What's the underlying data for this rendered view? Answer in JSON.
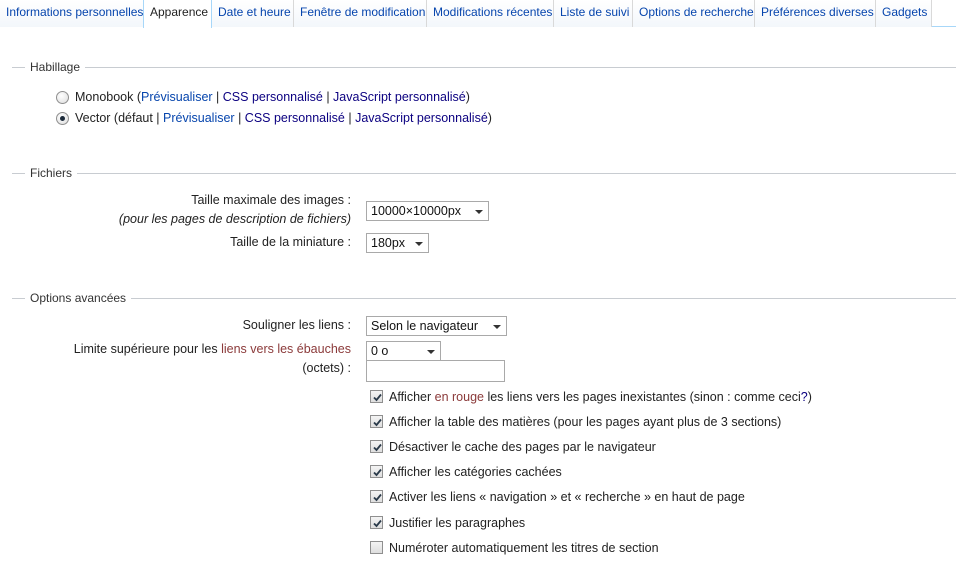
{
  "tabs": [
    {
      "label": "Informations personnelles",
      "active": false
    },
    {
      "label": "Apparence",
      "active": true
    },
    {
      "label": "Date et heure",
      "active": false
    },
    {
      "label": "Fenêtre de modification",
      "active": false
    },
    {
      "label": "Modifications récentes",
      "active": false
    },
    {
      "label": "Liste de suivi",
      "active": false
    },
    {
      "label": "Options de recherche",
      "active": false
    },
    {
      "label": "Préférences diverses",
      "active": false
    },
    {
      "label": "Gadgets",
      "active": false
    }
  ],
  "habillage": {
    "legend": "Habillage",
    "skins": [
      {
        "name": "Monobook (",
        "checked": false,
        "preview": "Prévisualiser",
        "sep1": " | ",
        "css": "CSS personnalisé",
        "sep2": " | ",
        "js": "JavaScript personnalisé",
        "close": ")"
      },
      {
        "name": "Vector (défaut | ",
        "checked": true,
        "preview": "Prévisualiser",
        "sep1": " | ",
        "css": "CSS personnalisé",
        "sep2": " | ",
        "js": "JavaScript personnalisé",
        "close": ")"
      }
    ]
  },
  "fichiers": {
    "legend": "Fichiers",
    "max_image_label": "Taille maximale des images :",
    "max_image_sublabel": "(pour les pages de description de fichiers)",
    "max_image_value": "10000×10000px",
    "thumb_label": "Taille de la miniature :",
    "thumb_value": "180px"
  },
  "avancees": {
    "legend": "Options avancées",
    "underline_label": "Souligner les liens :",
    "underline_value": "Selon le navigateur",
    "stub_label_prefix": "Limite supérieure pour les ",
    "stub_label_link": "liens vers les ébauches",
    "stub_label_suffix": "(octets) :",
    "stub_value": "0 o",
    "stub_text_value": "",
    "checkboxes": [
      {
        "checked": true,
        "prefix": "Afficher ",
        "link1": "en rouge",
        "middle": " les liens vers les pages inexistantes (sinon : comme ceci",
        "link2": "?",
        "suffix": ")"
      },
      {
        "checked": true,
        "text": "Afficher la table des matières (pour les pages ayant plus de 3 sections)"
      },
      {
        "checked": true,
        "text": "Désactiver le cache des pages par le navigateur"
      },
      {
        "checked": true,
        "text": "Afficher les catégories cachées"
      },
      {
        "checked": true,
        "text": "Activer les liens « navigation » et « recherche » en haut de page"
      },
      {
        "checked": true,
        "text": "Justifier les paragraphes"
      },
      {
        "checked": false,
        "text": "Numéroter automatiquement les titres de section"
      }
    ]
  }
}
